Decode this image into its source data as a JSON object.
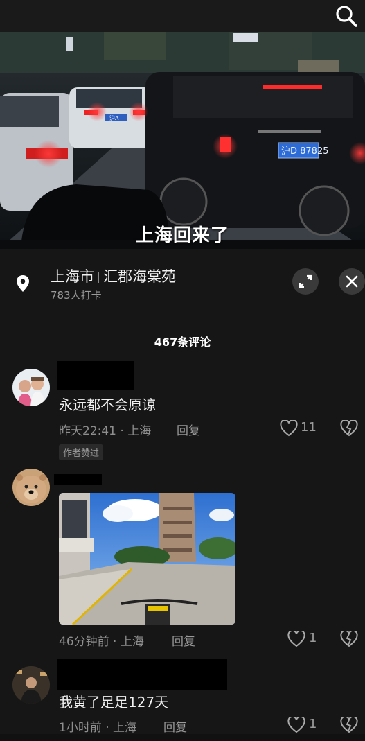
{
  "video": {
    "caption": "上海回来了",
    "plate": "沪D 87825",
    "plate_small": "沪A"
  },
  "location": {
    "city": "上海市",
    "place": "汇郡海棠苑",
    "checkins": "783人打卡"
  },
  "comments_header": "467条评论",
  "comments": [
    {
      "text": "永远都不会原谅",
      "time_loc": "昨天22:41 · 上海",
      "reply": "回复",
      "likes": "11",
      "badge": "作者赞过"
    },
    {
      "time_loc": "46分钟前 · 上海",
      "reply": "回复",
      "likes": "1"
    },
    {
      "text": "我黄了足足127天",
      "time_loc": "1小时前 · 上海",
      "reply": "回复",
      "likes": "1"
    }
  ]
}
